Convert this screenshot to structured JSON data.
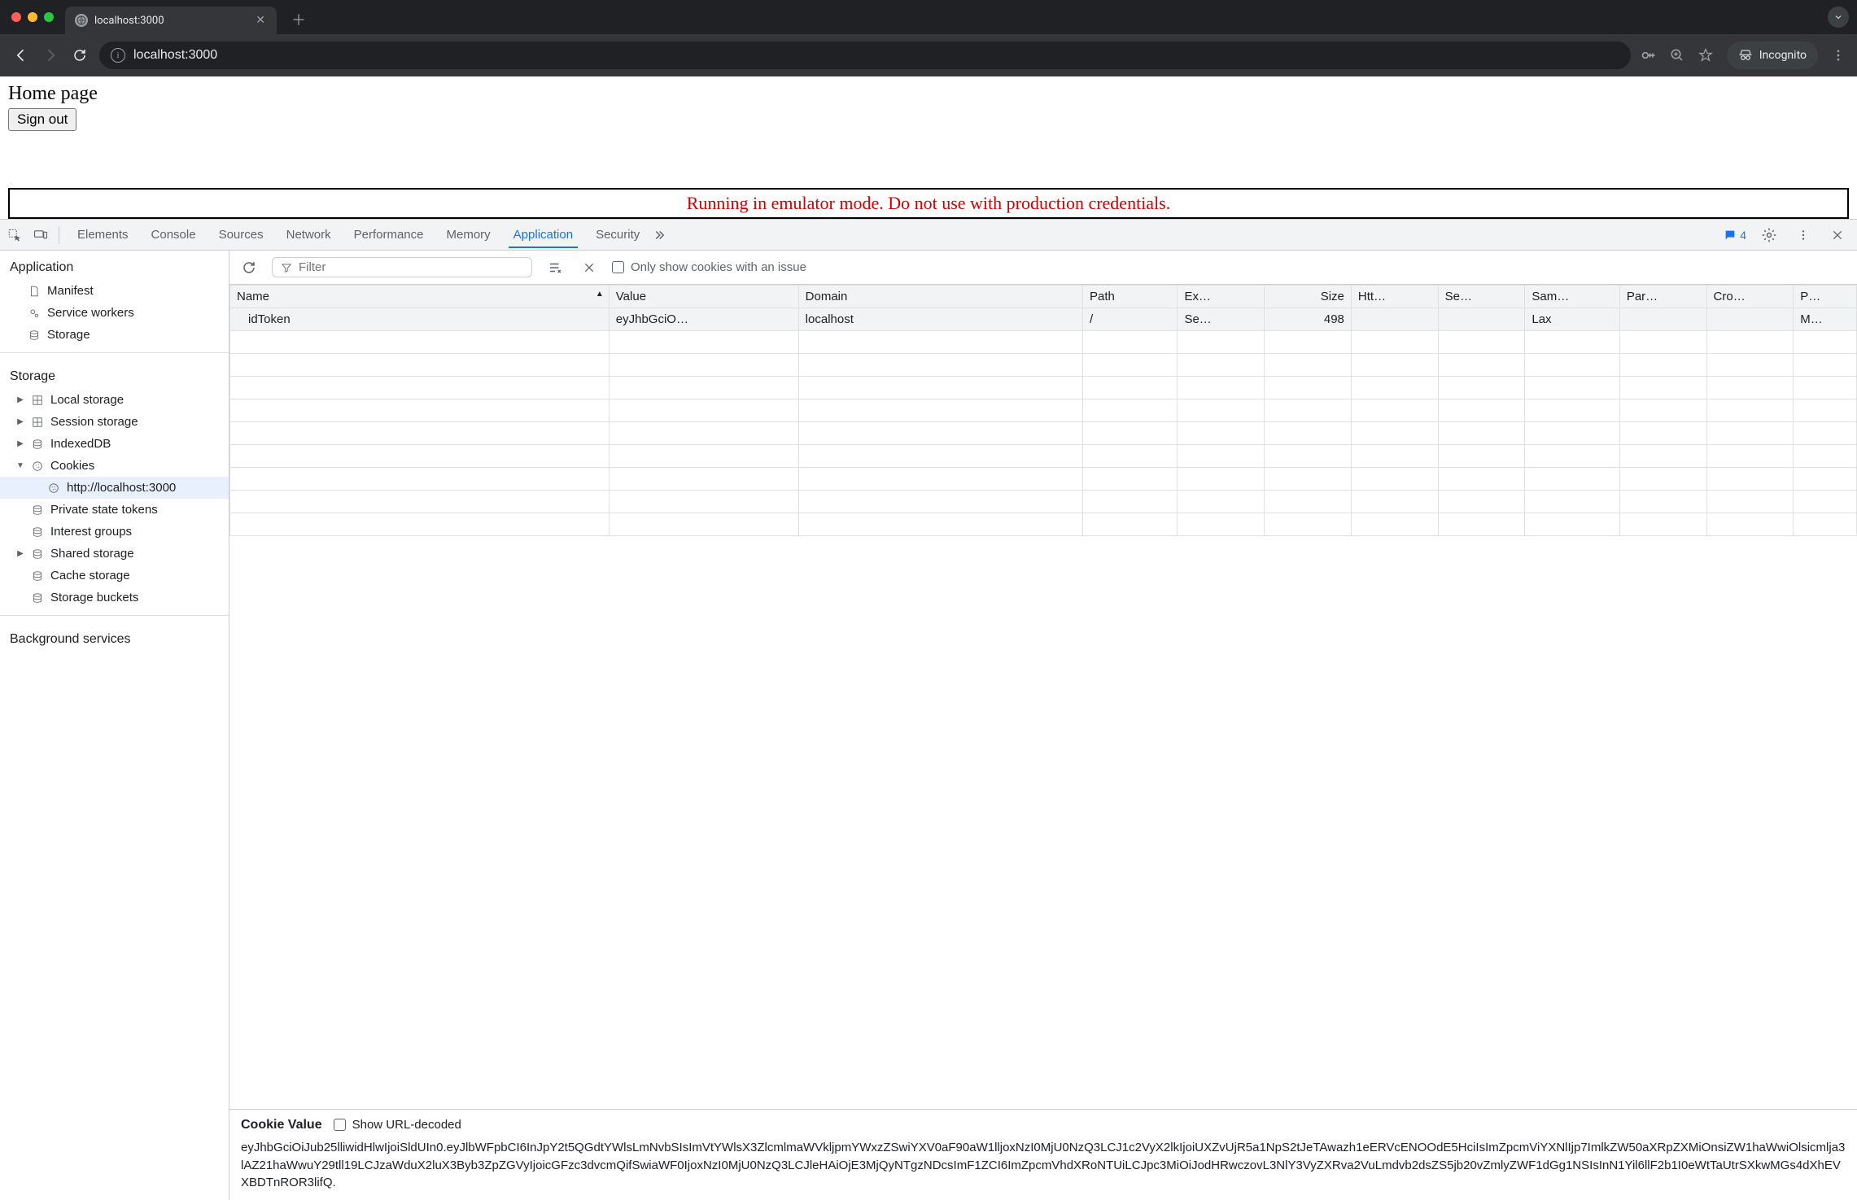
{
  "browser": {
    "tab_title": "localhost:3000",
    "url": "localhost:3000",
    "incognito_label": "Incognito"
  },
  "page": {
    "heading": "Home page",
    "signout_label": "Sign out",
    "emulator_warning": "Running in emulator mode. Do not use with production credentials."
  },
  "devtools": {
    "tabs": [
      "Elements",
      "Console",
      "Sources",
      "Network",
      "Performance",
      "Memory",
      "Application",
      "Security"
    ],
    "active_tab": "Application",
    "chat_count": "4",
    "sidebar": {
      "section_app": "Application",
      "items_app": [
        "Manifest",
        "Service workers",
        "Storage"
      ],
      "section_storage": "Storage",
      "items_storage": [
        {
          "label": "Local storage",
          "expandable": true
        },
        {
          "label": "Session storage",
          "expandable": true
        },
        {
          "label": "IndexedDB",
          "expandable": true
        },
        {
          "label": "Cookies",
          "expandable": true,
          "expanded": true,
          "child": "http://localhost:3000"
        },
        {
          "label": "Private state tokens",
          "expandable": false
        },
        {
          "label": "Interest groups",
          "expandable": false
        },
        {
          "label": "Shared storage",
          "expandable": true
        },
        {
          "label": "Cache storage",
          "expandable": false
        },
        {
          "label": "Storage buckets",
          "expandable": false
        }
      ],
      "section_bg": "Background services"
    },
    "filter": {
      "placeholder": "Filter",
      "only_issues_label": "Only show cookies with an issue"
    },
    "cookies": {
      "headers": [
        "Name",
        "Value",
        "Domain",
        "Path",
        "Ex…",
        "Size",
        "Htt…",
        "Se…",
        "Sam…",
        "Par…",
        "Cro…",
        "P…"
      ],
      "rows": [
        {
          "name": "idToken",
          "value": "eyJhbGciO…",
          "domain": "localhost",
          "path": "/",
          "expires": "Se…",
          "size": "498",
          "http": "",
          "secure": "",
          "samesite": "Lax",
          "partition": "",
          "crosssite": "",
          "priority": "M…"
        }
      ]
    },
    "cookie_detail": {
      "title": "Cookie Value",
      "decode_label": "Show URL-decoded",
      "value": "eyJhbGciOiJub25lliwidHlwIjoiSldUIn0.eyJlbWFpbCI6InJpY2t5QGdtYWlsLmNvbSIsImVtYWlsX3ZlcmlmaWVkljpmYWxzZSwiYXV0aF90aW1lljoxNzI0MjU0NzQ3LCJ1c2VyX2lkIjoiUXZvUjR5a1NpS2tJeTAwazh1eERVcENOOdE5HciIsImZpcmViYXNlIjp7ImlkZW50aXRpZXMiOnsiZW1haWwiOlsicmlja3lAZ21haWwuY29tll19LCJzaWduX2luX3Byb3ZpZGVyIjoicGFzc3dvcmQifSwiaWF0IjoxNzI0MjU0NzQ3LCJleHAiOjE3MjQyNTgzNDcsImF1ZCI6ImZpcmVhdXRoNTUiLCJpc3MiOiJodHRwczovL3NlY3VyZXRva2VuLmdvb2dsZS5jb20vZmlyZWF1dGg1NSIsInN1Yil6llF2b1I0eWtTaUtrSXkwMGs4dXhEVXBDTnROR3lifQ."
    }
  }
}
